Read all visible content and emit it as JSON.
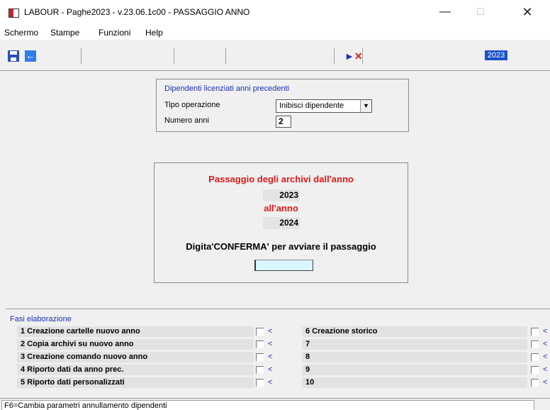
{
  "window": {
    "title": "LABOUR - Paghe2023 - v.23.06.1c00 - PASSAGGIO ANNO",
    "minimize": "—",
    "maximize": "☐",
    "close": "✕"
  },
  "menu": {
    "items": [
      {
        "label": "Schermo"
      },
      {
        "label": "Stampe"
      },
      {
        "label": "Funzioni"
      },
      {
        "label": "Help"
      }
    ]
  },
  "toolbar": {
    "year_badge": "2023",
    "icons": [
      "save-icon",
      "back-icon",
      "cancel-x-icon"
    ]
  },
  "licenziati": {
    "title": "Dipendenti licenziati anni precedenti",
    "tipo_label": "Tipo operazione",
    "tipo_value": "Inibisci dipendente",
    "numero_label": "Numero anni",
    "numero_value": "2"
  },
  "passaggio": {
    "title": "Passaggio degli archivi dall'anno",
    "from_year": "2023",
    "to_label": "all'anno",
    "to_year": "2024",
    "instruction": "Digita'CONFERMA' per avviare il passaggio",
    "confirm_value": ""
  },
  "fasi": {
    "title": "Fasi elaborazione",
    "left": [
      {
        "label": "1 Creazione cartelle nuovo anno",
        "checked": false
      },
      {
        "label": "2 Copia archivi su nuovo anno",
        "checked": false
      },
      {
        "label": "3 Creazione comando nuovo anno",
        "checked": false
      },
      {
        "label": "4 Riporto dati da anno prec.",
        "checked": false
      },
      {
        "label": "5 Riporto dati personalizzati",
        "checked": false
      }
    ],
    "right": [
      {
        "label": "6 Creazione storico",
        "checked": false
      },
      {
        "label": "7",
        "checked": false
      },
      {
        "label": "8",
        "checked": false
      },
      {
        "label": "9",
        "checked": false
      },
      {
        "label": "10",
        "checked": false
      }
    ]
  },
  "status": {
    "text": "F6=Cambia parametri annullamento dipendenti"
  },
  "colors": {
    "accent_blue": "#1a2fb5",
    "alert_red": "#e01818",
    "year_badge_bg": "#1a50c8"
  }
}
